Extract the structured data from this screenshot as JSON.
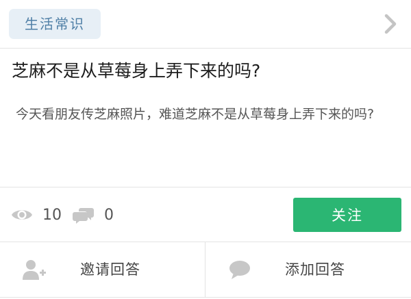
{
  "category": {
    "label": "生活常识",
    "chevron_icon": "chevron-right-icon"
  },
  "question": {
    "title": "芝麻不是从草莓身上弄下来的吗?",
    "description": "今天看朋友传芝麻照片，难道芝麻不是从草莓身上弄下来的吗?"
  },
  "stats": {
    "views_icon": "eye-icon",
    "views": "10",
    "comments_icon": "chat-bubbles-icon",
    "comments": "0"
  },
  "follow": {
    "label": "关注"
  },
  "actions": {
    "invite": {
      "icon": "add-user-icon",
      "label": "邀请回答"
    },
    "answer": {
      "icon": "comment-icon",
      "label": "添加回答"
    }
  },
  "colors": {
    "tag_background": "#e7eff6",
    "tag_text": "#4f7fa6",
    "follow_button": "#2bb673",
    "icon_gray": "#c7c7c7"
  }
}
